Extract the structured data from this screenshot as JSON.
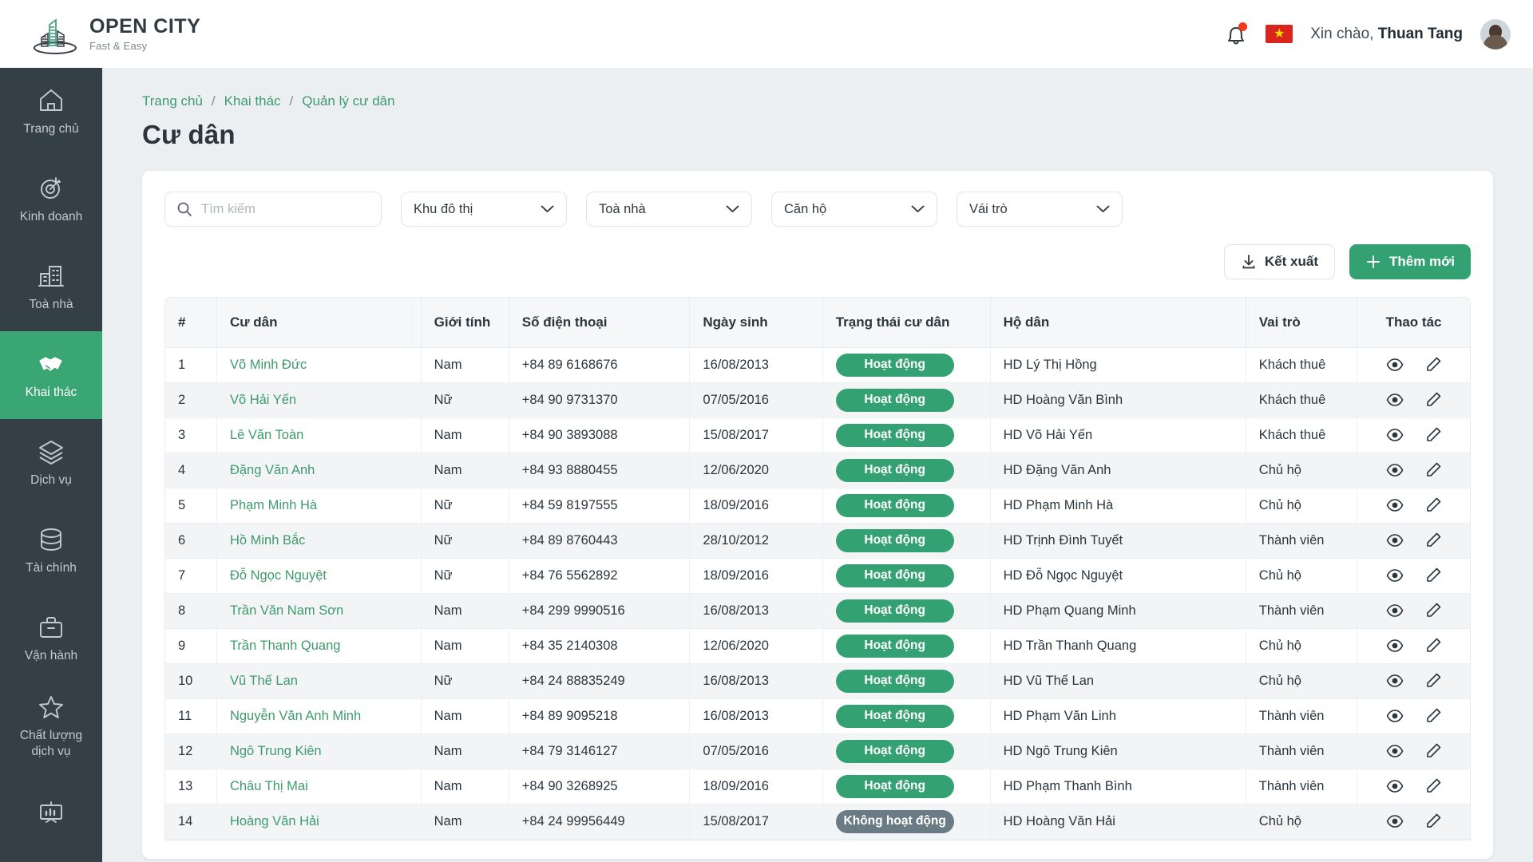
{
  "header": {
    "brand_title": "OPEN CITY",
    "brand_sub": "Fast & Easy",
    "greeting_prefix": "Xin chào,",
    "user_name": "Thuan Tang",
    "bell_icon": "bell-icon",
    "flag_icon": "vietnam-flag-icon",
    "flag_star": "★"
  },
  "sidebar": {
    "items": [
      {
        "label": "Trang chủ",
        "icon": "home-icon",
        "active": false
      },
      {
        "label": "Kinh doanh",
        "icon": "target-icon",
        "active": false
      },
      {
        "label": "Toà nhà",
        "icon": "building-icon",
        "active": false
      },
      {
        "label": "Khai thác",
        "icon": "handshake-icon",
        "active": true
      },
      {
        "label": "Dịch vụ",
        "icon": "layers-icon",
        "active": false
      },
      {
        "label": "Tài chính",
        "icon": "database-icon",
        "active": false
      },
      {
        "label": "Vận hành",
        "icon": "briefcase-icon",
        "active": false
      },
      {
        "label": "Chất lượng\ndịch vụ",
        "icon": "star-icon",
        "active": false
      },
      {
        "label": "",
        "icon": "presentation-chart-icon",
        "active": false
      }
    ]
  },
  "breadcrumb": {
    "items": [
      "Trang chủ",
      "Khai thác",
      "Quản lý cư dân"
    ],
    "separator": "/"
  },
  "page": {
    "title": "Cư dân"
  },
  "filters": {
    "search": {
      "placeholder": "Tìm kiếm",
      "value": "",
      "icon": "search-icon"
    },
    "selects": [
      {
        "label": "Khu đô thị",
        "icon": "chevron-down-icon"
      },
      {
        "label": "Toà nhà",
        "icon": "chevron-down-icon"
      },
      {
        "label": "Căn hộ",
        "icon": "chevron-down-icon"
      },
      {
        "label": "Vái trò",
        "icon": "chevron-down-icon"
      }
    ]
  },
  "toolbar": {
    "export_label": "Kết xuất",
    "export_icon": "download-icon",
    "add_label": "Thêm mới",
    "add_icon": "plus-icon"
  },
  "table": {
    "columns": [
      "#",
      "Cư dân",
      "Giới tính",
      "Số điện thoại",
      "Ngày sinh",
      "Trạng thái cư dân",
      "Hộ dân",
      "Vai trò",
      "Thao tác"
    ],
    "row_icons": {
      "view": "eye-icon",
      "edit": "pencil-icon"
    },
    "rows": [
      {
        "idx": "1",
        "name": "Võ Minh Đức",
        "gender": "Nam",
        "phone": "+84 89 6168676",
        "dob": "16/08/2013",
        "status": "Hoạt động",
        "status_type": "active",
        "household": "HD Lý Thị Hồng",
        "role": "Khách thuê"
      },
      {
        "idx": "2",
        "name": "Võ Hải Yến",
        "gender": "Nữ",
        "phone": "+84 90 9731370",
        "dob": "07/05/2016",
        "status": "Hoạt động",
        "status_type": "active",
        "household": "HD Hoàng Văn Bình",
        "role": "Khách thuê"
      },
      {
        "idx": "3",
        "name": "Lê Văn Toàn",
        "gender": "Nam",
        "phone": "+84 90 3893088",
        "dob": "15/08/2017",
        "status": "Hoạt động",
        "status_type": "active",
        "household": "HD Võ Hải Yến",
        "role": "Khách thuê"
      },
      {
        "idx": "4",
        "name": "Đặng Văn Anh",
        "gender": "Nam",
        "phone": "+84 93 8880455",
        "dob": "12/06/2020",
        "status": "Hoạt động",
        "status_type": "active",
        "household": "HD Đặng Văn Anh",
        "role": "Chủ hộ"
      },
      {
        "idx": "5",
        "name": "Phạm Minh Hà",
        "gender": "Nữ",
        "phone": "+84 59 8197555",
        "dob": "18/09/2016",
        "status": "Hoạt động",
        "status_type": "active",
        "household": "HD Phạm Minh Hà",
        "role": "Chủ hộ"
      },
      {
        "idx": "6",
        "name": "Hồ Minh Bắc",
        "gender": "Nữ",
        "phone": "+84 89 8760443",
        "dob": "28/10/2012",
        "status": "Hoạt động",
        "status_type": "active",
        "household": "HD Trịnh Đình Tuyết",
        "role": "Thành viên"
      },
      {
        "idx": "7",
        "name": "Đỗ Ngọc Nguyệt",
        "gender": "Nữ",
        "phone": "+84 76 5562892",
        "dob": "18/09/2016",
        "status": "Hoạt động",
        "status_type": "active",
        "household": "HD Đỗ Ngọc Nguyệt",
        "role": "Chủ hộ"
      },
      {
        "idx": "8",
        "name": "Trần Văn Nam Sơn",
        "gender": "Nam",
        "phone": "+84 299 9990516",
        "dob": "16/08/2013",
        "status": "Hoạt động",
        "status_type": "active",
        "household": "HD Phạm Quang Minh",
        "role": "Thành viên"
      },
      {
        "idx": "9",
        "name": "Trần Thanh Quang",
        "gender": "Nam",
        "phone": "+84 35 2140308",
        "dob": "12/06/2020",
        "status": "Hoạt động",
        "status_type": "active",
        "household": "HD Trần Thanh Quang",
        "role": "Chủ hộ"
      },
      {
        "idx": "10",
        "name": "Vũ Thế Lan",
        "gender": "Nữ",
        "phone": "+84 24 88835249",
        "dob": "16/08/2013",
        "status": "Hoạt động",
        "status_type": "active",
        "household": "HD Vũ Thế Lan",
        "role": "Chủ hộ"
      },
      {
        "idx": "11",
        "name": "Nguyễn Văn Anh Minh",
        "gender": "Nam",
        "phone": "+84 89 9095218",
        "dob": "16/08/2013",
        "status": "Hoạt động",
        "status_type": "active",
        "household": "HD Phạm Văn Linh",
        "role": "Thành viên"
      },
      {
        "idx": "12",
        "name": "Ngô Trung Kiên",
        "gender": "Nam",
        "phone": "+84 79 3146127",
        "dob": "07/05/2016",
        "status": "Hoạt động",
        "status_type": "active",
        "household": "HD Ngô Trung Kiên",
        "role": "Thành viên"
      },
      {
        "idx": "13",
        "name": "Châu Thị Mai",
        "gender": "Nam",
        "phone": "+84 90 3268925",
        "dob": "18/09/2016",
        "status": "Hoạt động",
        "status_type": "active",
        "household": "HD Phạm Thanh Bình",
        "role": "Thành viên"
      },
      {
        "idx": "14",
        "name": "Hoàng Văn Hải",
        "gender": "Nam",
        "phone": "+84 24 99956449",
        "dob": "15/08/2017",
        "status": "Không hoạt động",
        "status_type": "inactive",
        "household": "HD Hoàng Văn Hải",
        "role": "Chủ hộ"
      }
    ]
  },
  "colors": {
    "brand_green": "#34a173",
    "sidebar_bg": "#353f46",
    "page_bg": "#eceff1",
    "link_green": "#3f9a6f",
    "badge_inactive": "#6b7b85",
    "notify_red": "#f03a17"
  }
}
